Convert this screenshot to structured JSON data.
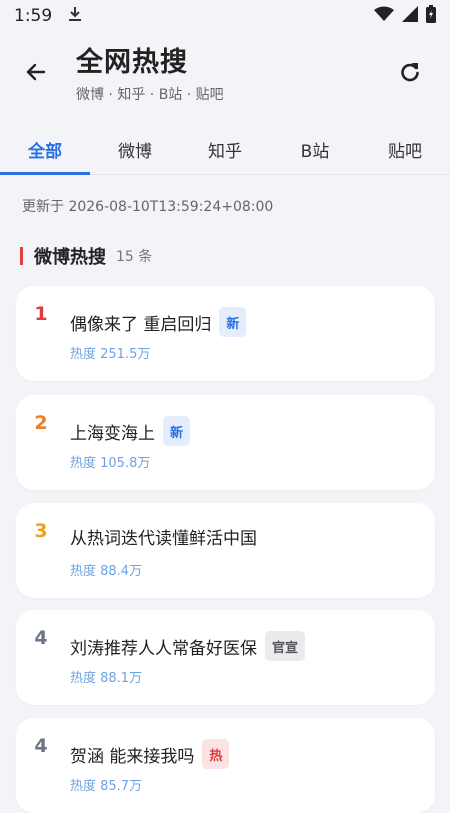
{
  "status_bar": {
    "time": "1:59",
    "download_icon": "download-icon",
    "wifi_icon": "wifi-icon",
    "signal_icon": "signal-icon",
    "battery_icon": "battery-icon"
  },
  "header": {
    "title": "全网热搜",
    "subtitle": "微博 · 知乎 · B站 · 贴吧",
    "back_icon": "arrow-left-icon",
    "refresh_icon": "refresh-icon"
  },
  "tabs": [
    {
      "label": "全部",
      "active": true
    },
    {
      "label": "微博",
      "active": false
    },
    {
      "label": "知乎",
      "active": false
    },
    {
      "label": "B站",
      "active": false
    },
    {
      "label": "贴吧",
      "active": false
    }
  ],
  "updated_text": "更新于 2026-08-10T13:59:24+08:00",
  "section": {
    "title": "微博热搜",
    "count": "15 条"
  },
  "items": [
    {
      "rank": "1",
      "title": "偶像来了 重启回归",
      "badge": "新",
      "hot": "热度 251.5万"
    },
    {
      "rank": "2",
      "title": "上海变海上",
      "badge": "新",
      "hot": "热度 105.8万"
    },
    {
      "rank": "3",
      "title": "从热词迭代读懂鲜活中国",
      "badge": "",
      "hot": "热度 88.4万"
    },
    {
      "rank": "4",
      "title": "刘涛推荐人人常备好医保",
      "badge": "官宣",
      "hot": "热度 88.1万"
    },
    {
      "rank": "4",
      "title": "贺涵 能来接我吗",
      "badge": "热",
      "hot": "热度 85.7万"
    }
  ],
  "colors": {
    "accent": "#2b6fe6",
    "rank1": "#e0393e",
    "rank2": "#ef7d22",
    "rank3": "#f0a21e",
    "rank_default": "#6b7585",
    "badge_new_bg": "#e3edfb",
    "badge_new_fg": "#2b6fe6",
    "badge_official_bg": "#e9ebef",
    "badge_official_fg": "#555555",
    "badge_hot_bg": "#fbe3e4",
    "badge_hot_fg": "#e0393e"
  }
}
